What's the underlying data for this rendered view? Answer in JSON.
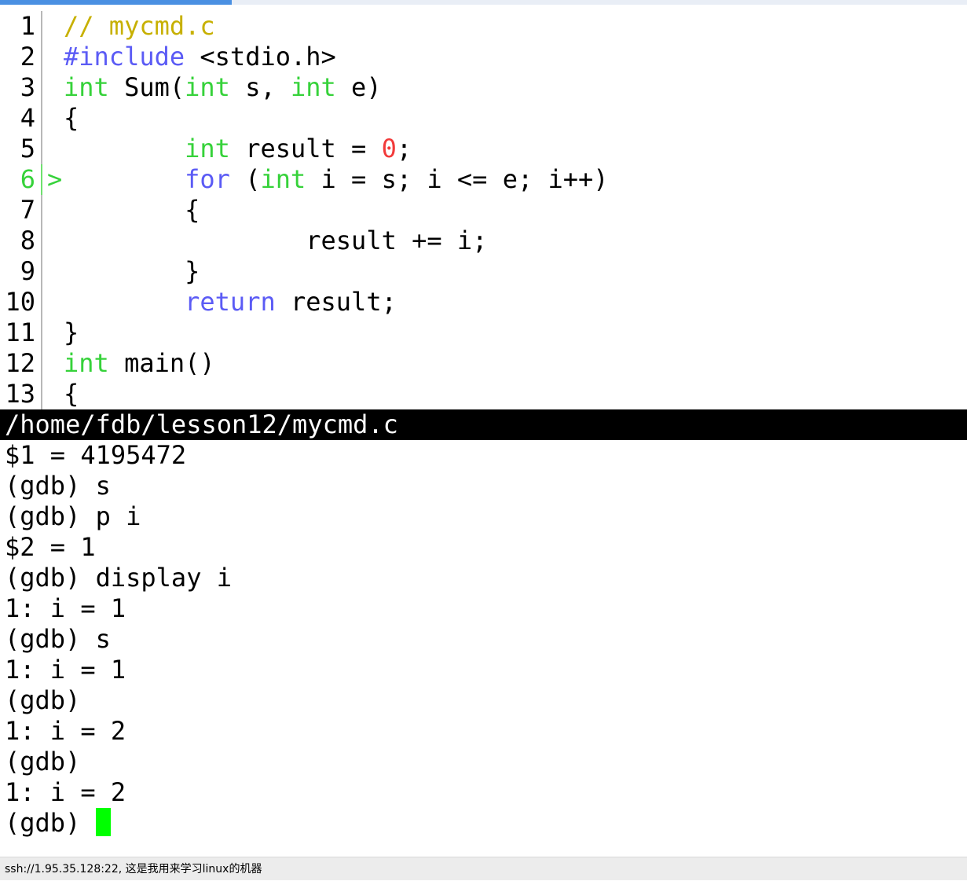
{
  "window": {
    "progress_fraction": 0.24,
    "accent_color": "#4a90e2"
  },
  "source": {
    "current_line_marker": ">",
    "lines": [
      {
        "n": "1",
        "tokens": [
          {
            "t": "// mycmd.c",
            "c": "tok-comment"
          }
        ]
      },
      {
        "n": "2",
        "tokens": [
          {
            "t": "#include",
            "c": "tok-pre"
          },
          {
            "t": " <stdio.h>",
            "c": ""
          }
        ]
      },
      {
        "n": "3",
        "tokens": [
          {
            "t": "int",
            "c": "tok-type"
          },
          {
            "t": " Sum(",
            "c": ""
          },
          {
            "t": "int",
            "c": "tok-type"
          },
          {
            "t": " s, ",
            "c": ""
          },
          {
            "t": "int",
            "c": "tok-type"
          },
          {
            "t": " e)",
            "c": ""
          }
        ]
      },
      {
        "n": "4",
        "tokens": [
          {
            "t": "{",
            "c": ""
          }
        ]
      },
      {
        "n": "5",
        "tokens": [
          {
            "t": "        ",
            "c": ""
          },
          {
            "t": "int",
            "c": "tok-type"
          },
          {
            "t": " result = ",
            "c": ""
          },
          {
            "t": "0",
            "c": "tok-num"
          },
          {
            "t": ";",
            "c": ""
          }
        ]
      },
      {
        "n": "6",
        "current": true,
        "tokens": [
          {
            "t": "        ",
            "c": ""
          },
          {
            "t": "for",
            "c": "tok-kw"
          },
          {
            "t": " (",
            "c": ""
          },
          {
            "t": "int",
            "c": "tok-type"
          },
          {
            "t": " i = s; i <= e; i++)",
            "c": ""
          }
        ]
      },
      {
        "n": "7",
        "tokens": [
          {
            "t": "        {",
            "c": ""
          }
        ]
      },
      {
        "n": "8",
        "tokens": [
          {
            "t": "                result += i;",
            "c": ""
          }
        ]
      },
      {
        "n": "9",
        "tokens": [
          {
            "t": "        }",
            "c": ""
          }
        ]
      },
      {
        "n": "10",
        "tokens": [
          {
            "t": "        ",
            "c": ""
          },
          {
            "t": "return",
            "c": "tok-kw"
          },
          {
            "t": " result;",
            "c": ""
          }
        ]
      },
      {
        "n": "11",
        "tokens": [
          {
            "t": "}",
            "c": ""
          }
        ]
      },
      {
        "n": "12",
        "tokens": [
          {
            "t": "int",
            "c": "tok-type"
          },
          {
            "t": " main()",
            "c": ""
          }
        ]
      },
      {
        "n": "13",
        "tokens": [
          {
            "t": "{",
            "c": ""
          }
        ]
      }
    ]
  },
  "status_line": {
    "path": "/home/fdb/lesson12/mycmd.c"
  },
  "gdb_output": [
    "$1 = 4195472",
    "(gdb) s",
    "(gdb) p i",
    "$2 = 1",
    "(gdb) display i",
    "1: i = 1",
    "(gdb) s",
    "1: i = 1",
    "(gdb)",
    "1: i = 2",
    "(gdb)",
    "1: i = 2"
  ],
  "prompt": {
    "text": "(gdb) ",
    "cursor_color": "#00ff00"
  },
  "footer": {
    "connection": "ssh://1.95.35.128:22, 这是我用来学习linux的机器"
  },
  "colors": {
    "type": "#36d23a",
    "keyword": "#5b5bf5",
    "comment": "#c7b000",
    "number": "#f23a3a"
  }
}
